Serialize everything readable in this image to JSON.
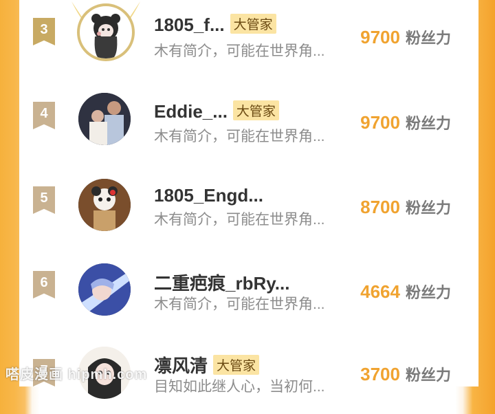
{
  "unit_label": "粉丝力",
  "list": [
    {
      "rank": "3",
      "name": "1805_f...",
      "badge": "大管家",
      "bio": "木有简介，可能在世界角...",
      "score": "9700",
      "avatar_icon": "panda-girl-avatar-icon"
    },
    {
      "rank": "4",
      "name": "Eddie_...",
      "badge": "大管家",
      "bio": "木有简介，可能在世界角...",
      "score": "9700",
      "avatar_icon": "family-photo-avatar-icon"
    },
    {
      "rank": "5",
      "name": "1805_Engd...",
      "badge": "",
      "bio": "木有简介，可能在世界角...",
      "score": "8700",
      "avatar_icon": "plush-doll-avatar-icon"
    },
    {
      "rank": "6",
      "name": "二重疤痕_rbRy...",
      "badge": "",
      "bio": "木有简介，可能在世界角...",
      "score": "4664",
      "avatar_icon": "anime-character-avatar-icon"
    },
    {
      "rank": "7",
      "name": "凛风清",
      "badge": "大管家",
      "bio": "目知如此继人心，当初何...",
      "score": "3700",
      "avatar_icon": "anime-girl-avatar-icon"
    }
  ],
  "watermark": "嗒皮漫画 hipmh.com"
}
